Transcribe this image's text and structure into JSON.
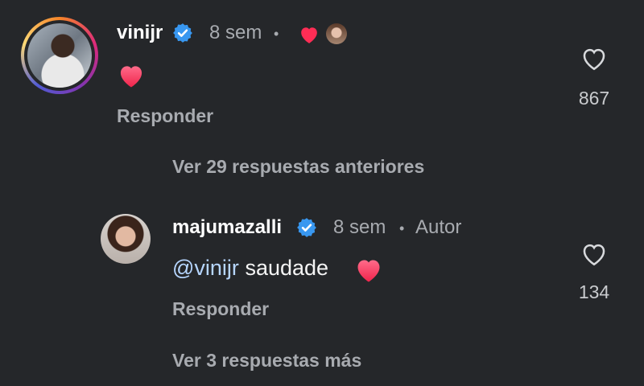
{
  "comment1": {
    "username": "vinijr",
    "time": "8 sem",
    "dot": "•",
    "body": "❤️",
    "reply_label": "Responder",
    "likes": "867"
  },
  "more_previous": "Ver 29 respuestas anteriores",
  "comment2": {
    "username": "majumazalli",
    "time": "8 sem",
    "dot": "•",
    "author_label": "Autor",
    "mention": "@vinijr",
    "text": "saudade",
    "emoji": "❤️",
    "reply_label": "Responder",
    "likes": "134"
  },
  "more_next": "Ver 3 respuestas más",
  "colors": {
    "background": "#25272a",
    "verified": "#3897f0",
    "heart": "#ff2d55",
    "mention": "#b6d6ff"
  }
}
